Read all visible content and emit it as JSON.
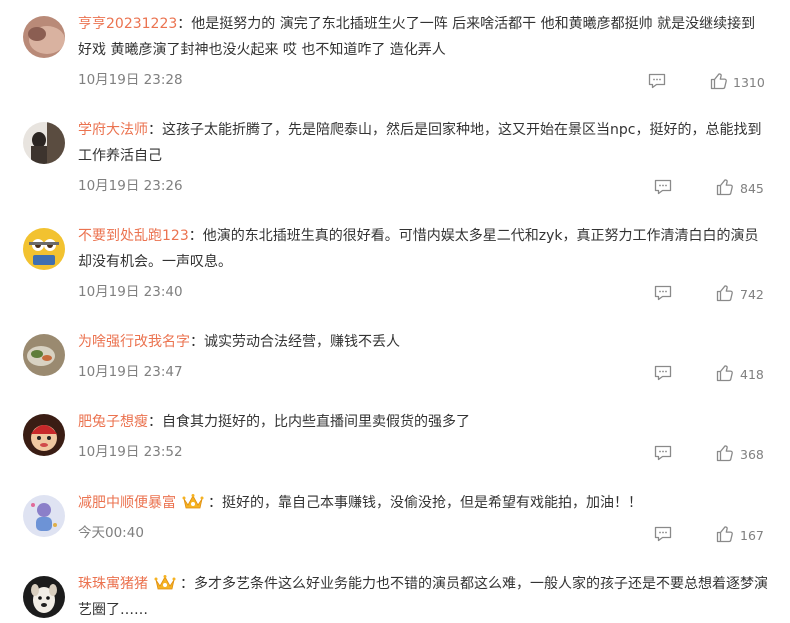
{
  "colors": {
    "username": "#eb7350",
    "text": "#333333",
    "meta": "#808080",
    "icon": "#8a8a8a"
  },
  "comments": [
    {
      "user": "亨亨20231223",
      "text": "：他是挺努力的 演完了东北插班生火了一阵 后来啥活都干 他和黄曦彦都挺帅 就是没继续接到好戏 黄曦彦演了封神也没火起来 哎 也不知道咋了 造化弄人",
      "time": "10月19日 23:28",
      "likes": "1310",
      "badge": ""
    },
    {
      "user": "学府大法师",
      "text": "：这孩子太能折腾了，先是陪爬泰山，然后是回家种地，这又开始在景区当npc，挺好的，总能找到工作养活自己",
      "time": "10月19日 23:26",
      "likes": "845",
      "badge": ""
    },
    {
      "user": "不要到处乱跑123",
      "text": "：他演的东北插班生真的很好看。可惜内娱太多星二代和zyk，真正努力工作清清白白的演员却没有机会。一声叹息。",
      "time": "10月19日 23:40",
      "likes": "742",
      "badge": ""
    },
    {
      "user": "为啥强行改我名字",
      "text": "：诚实劳动合法经营，赚钱不丢人",
      "time": "10月19日 23:47",
      "likes": "418",
      "badge": ""
    },
    {
      "user": "肥兔子想瘦",
      "text": "：自食其力挺好的，比内些直播间里卖假货的强多了",
      "time": "10月19日 23:52",
      "likes": "368",
      "badge": ""
    },
    {
      "user": "减肥中顺便暴富",
      "text": "：挺好的，靠自己本事赚钱，没偷没抢，但是希望有戏能拍，加油！！",
      "time": "今天00:40",
      "likes": "167",
      "badge": "crown-icon"
    },
    {
      "user": "珠珠寓猪猪",
      "text": "：多才多艺条件这么好业务能力也不错的演员都这么难，一般人家的孩子还是不要总想着逐梦演艺圈了……",
      "time": "",
      "likes": "",
      "badge": "crown-icon"
    }
  ]
}
